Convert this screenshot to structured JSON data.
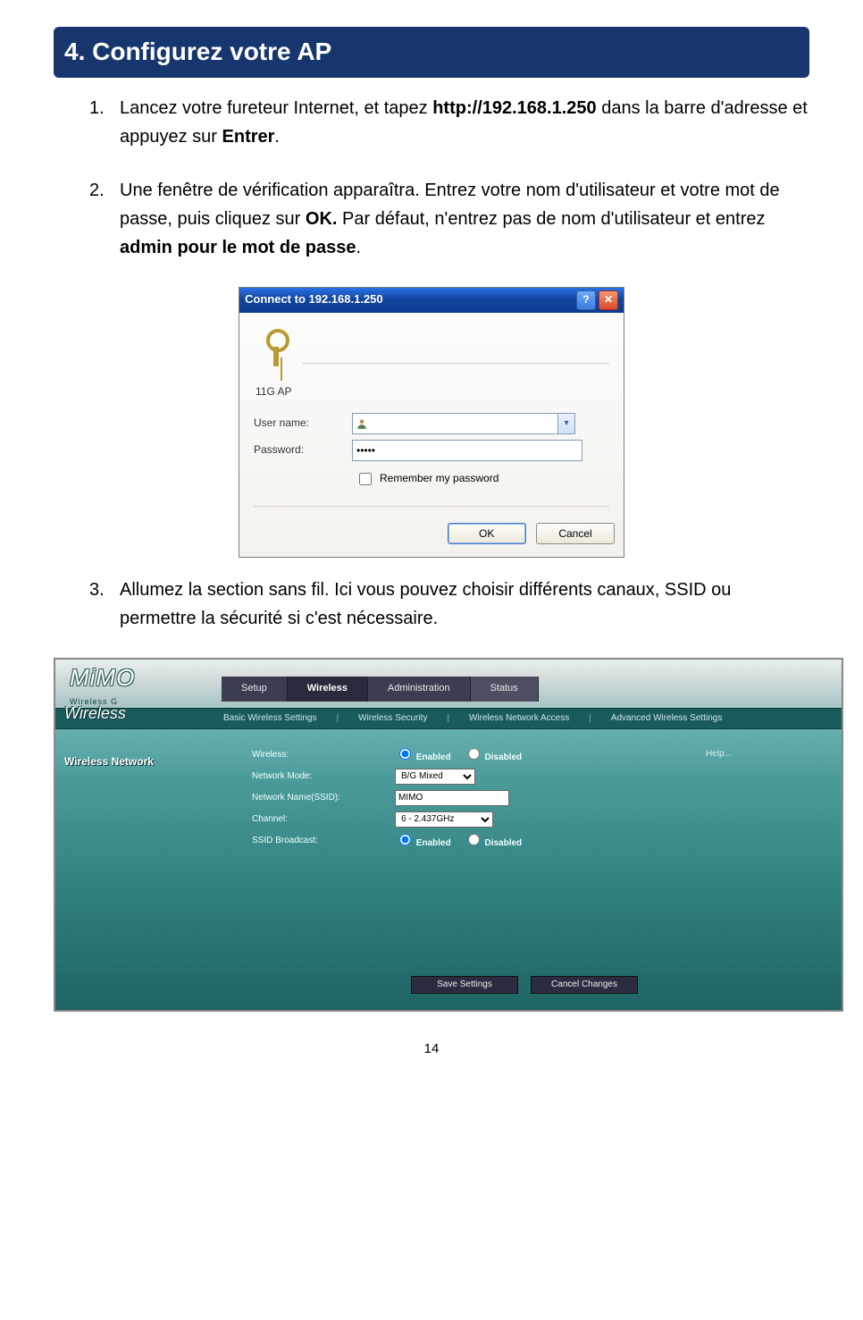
{
  "section_title": "4. Configurez votre AP",
  "steps": [
    {
      "num": "1.",
      "text_before": "Lancez votre fureteur Internet, et tapez ",
      "bold1": "http://192.168.1.250",
      "text_middle": " dans la barre d'adresse et appuyez sur ",
      "bold2": "Entrer",
      "text_after": "."
    },
    {
      "num": "2.",
      "text_before": "Une fenêtre de vérification apparaîtra. Entrez votre nom d'utilisateur et votre mot de passe, puis cliquez sur ",
      "bold1": "OK.",
      "text_middle": " Par défaut, n'entrez pas de nom d'utilisateur et entrez ",
      "bold2": "admin pour le mot de passe",
      "text_after": "."
    },
    {
      "num": "3.",
      "text_before": "Allumez la section sans fil. Ici vous pouvez choisir différents canaux, SSID ou permettre la sécurité si c'est nécessaire.",
      "bold1": "",
      "text_middle": "",
      "bold2": "",
      "text_after": ""
    }
  ],
  "dialog": {
    "title": "Connect to 192.168.1.250",
    "help_glyph": "?",
    "close_glyph": "✕",
    "realm": "11G AP",
    "username_label": "User name:",
    "username_value": "",
    "username_dd": "▾",
    "password_label": "Password:",
    "password_value": "•••••",
    "remember_label": "Remember my password",
    "ok_label": "OK",
    "cancel_label": "Cancel"
  },
  "mimo": {
    "logo_text": "MiMO",
    "logo_sub": "Wireless G",
    "wireless_badge": "Wireless",
    "tabs": [
      "Setup",
      "Wireless",
      "Administration",
      "Status"
    ],
    "active_tab_index": 1,
    "subtabs": [
      "Basic Wireless Settings",
      "Wireless Security",
      "Wireless Network Access",
      "Advanced Wireless Settings"
    ],
    "side_title": "Wireless Network",
    "help_label": "Help...",
    "rows": {
      "wireless_label": "Wireless:",
      "mode_label": "Network Mode:",
      "mode_value": "B/G Mixed",
      "ssid_label": "Network Name(SSID):",
      "ssid_value": "MIMO",
      "channel_label": "Channel:",
      "channel_value": "6 - 2.437GHz",
      "broadcast_label": "SSID Broadcast:",
      "enabled_label": "Enabled",
      "disabled_label": "Disabled"
    },
    "save_label": "Save Settings",
    "cancel_label": "Cancel Changes"
  },
  "page_num": "14"
}
